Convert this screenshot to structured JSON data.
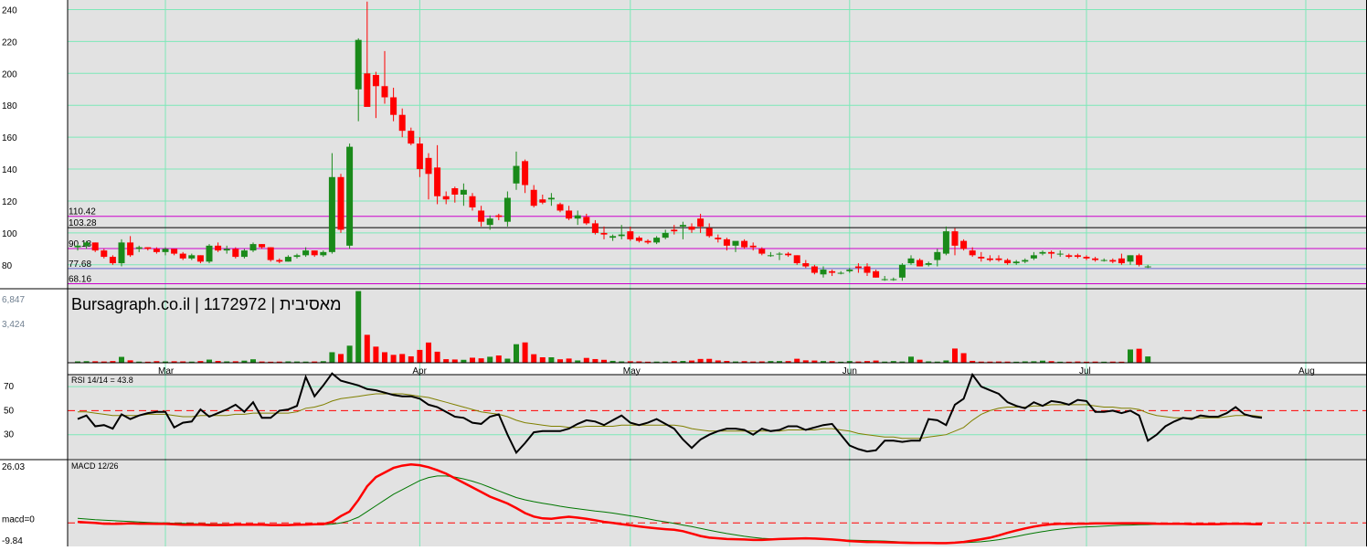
{
  "chart_data": {
    "type": "candlestick",
    "watermark": "Bursagraph.co.il | 1172972 | מאסיבית",
    "colors": {
      "up": "#1a8a1a",
      "down": "#ff0000",
      "grid": "#7de8b8",
      "panel_bg": "#e2e2e2",
      "level_magenta": "#cc00cc",
      "level_black": "#000000",
      "level_blue": "#6666cc"
    },
    "price": {
      "ylim": [
        65,
        246
      ],
      "yticks": [
        "80",
        "100",
        "120",
        "140",
        "160",
        "180",
        "200",
        "220",
        "240"
      ],
      "levels": [
        {
          "label": "110.42",
          "value": 110.42,
          "color": "#cc00cc"
        },
        {
          "label": "103.28",
          "value": 103.28,
          "color": "#000000"
        },
        {
          "label": "90.18",
          "value": 90.18,
          "color": "#cc00cc"
        },
        {
          "label": "77.68",
          "value": 77.68,
          "color": "#6666cc"
        },
        {
          "label": "68.16",
          "value": 68.16,
          "color": "#cc00cc"
        }
      ]
    },
    "months": [
      {
        "label": "Mar",
        "index": 10
      },
      {
        "label": "Apr",
        "index": 39
      },
      {
        "label": "May",
        "index": 63
      },
      {
        "label": "Jun",
        "index": 88
      },
      {
        "label": "Jul",
        "index": 115
      },
      {
        "label": "Aug",
        "index": 140
      }
    ],
    "candles": [
      [
        91,
        93,
        89,
        92
      ],
      [
        92,
        95,
        90,
        94
      ],
      [
        94,
        94,
        88,
        89
      ],
      [
        89,
        90,
        84,
        85
      ],
      [
        85,
        86,
        80,
        81
      ],
      [
        81,
        96,
        79,
        94
      ],
      [
        94,
        98,
        85,
        86
      ],
      [
        90,
        92,
        88,
        91
      ],
      [
        91,
        91,
        89,
        90
      ],
      [
        90,
        91,
        87,
        88
      ],
      [
        88,
        91,
        86,
        90
      ],
      [
        90,
        90,
        86,
        87
      ],
      [
        87,
        88,
        83,
        84
      ],
      [
        84,
        87,
        83,
        86
      ],
      [
        86,
        86,
        81,
        82
      ],
      [
        82,
        93,
        81,
        92
      ],
      [
        92,
        94,
        88,
        89
      ],
      [
        89,
        92,
        87,
        90
      ],
      [
        90,
        91,
        84,
        85
      ],
      [
        85,
        90,
        84,
        89
      ],
      [
        89,
        94,
        88,
        93
      ],
      [
        93,
        93,
        90,
        91
      ],
      [
        91,
        91,
        82,
        83
      ],
      [
        83,
        84,
        81,
        82
      ],
      [
        82,
        86,
        82,
        85
      ],
      [
        85,
        87,
        84,
        86
      ],
      [
        86,
        91,
        85,
        89
      ],
      [
        89,
        89,
        85,
        86
      ],
      [
        86,
        89,
        85,
        88
      ],
      [
        88,
        150,
        87,
        135
      ],
      [
        135,
        137,
        100,
        102
      ],
      [
        92,
        156,
        90,
        154
      ],
      [
        190,
        222,
        170,
        221
      ],
      [
        200,
        245,
        196,
        179
      ],
      [
        199,
        201,
        172,
        192
      ],
      [
        192,
        214,
        181,
        185
      ],
      [
        185,
        191,
        170,
        174
      ],
      [
        174,
        178,
        160,
        164
      ],
      [
        164,
        166,
        155,
        156
      ],
      [
        156,
        160,
        135,
        140
      ],
      [
        147,
        150,
        121,
        137
      ],
      [
        141,
        155,
        118,
        123
      ],
      [
        123,
        126,
        118,
        121
      ],
      [
        128,
        129,
        119,
        124
      ],
      [
        124,
        131,
        117,
        127
      ],
      [
        123,
        125,
        114,
        116
      ],
      [
        114,
        117,
        104,
        107
      ],
      [
        105,
        111,
        102,
        109
      ],
      [
        111,
        112,
        108,
        110
      ],
      [
        107,
        126,
        104,
        122
      ],
      [
        131,
        151,
        127,
        142
      ],
      [
        145,
        146,
        125,
        130
      ],
      [
        127,
        130,
        116,
        117
      ],
      [
        121,
        124,
        118,
        119
      ],
      [
        121,
        125,
        117,
        122
      ],
      [
        118,
        119,
        113,
        114
      ],
      [
        114,
        117,
        108,
        109
      ],
      [
        109,
        114,
        105,
        111
      ],
      [
        110,
        112,
        105,
        106
      ],
      [
        106,
        108,
        99,
        100
      ],
      [
        100,
        104,
        96,
        99
      ],
      [
        97,
        99,
        95,
        98
      ],
      [
        98,
        105,
        96,
        99
      ],
      [
        101,
        104,
        95,
        96
      ],
      [
        97,
        98,
        94,
        95
      ],
      [
        95,
        96,
        93,
        94
      ],
      [
        94,
        98,
        93,
        97
      ],
      [
        97,
        102,
        96,
        100
      ],
      [
        102,
        105,
        99,
        101
      ],
      [
        104,
        107,
        96,
        105
      ],
      [
        104,
        106,
        100,
        102
      ],
      [
        109,
        112,
        100,
        104
      ],
      [
        103,
        106,
        97,
        98
      ],
      [
        97,
        99,
        94,
        96
      ],
      [
        96,
        97,
        89,
        92
      ],
      [
        92,
        94,
        88,
        95
      ],
      [
        95,
        96,
        90,
        91
      ],
      [
        92,
        94,
        89,
        91
      ],
      [
        90,
        91,
        86,
        87
      ],
      [
        86,
        88,
        85,
        86
      ],
      [
        87,
        88,
        83,
        87
      ],
      [
        87,
        88,
        85,
        86
      ],
      [
        86,
        86,
        80,
        81
      ],
      [
        81,
        83,
        78,
        79
      ],
      [
        79,
        80,
        74,
        75
      ],
      [
        74,
        79,
        72,
        77
      ],
      [
        76,
        77,
        73,
        75
      ],
      [
        75,
        76,
        74,
        75
      ],
      [
        76,
        78,
        75,
        77
      ],
      [
        79,
        81,
        75,
        78
      ],
      [
        79,
        81,
        73,
        75
      ],
      [
        76,
        77,
        72,
        72
      ],
      [
        71,
        73,
        70,
        71
      ],
      [
        71,
        72,
        70,
        71
      ],
      [
        72,
        81,
        70,
        80
      ],
      [
        81,
        86,
        80,
        84
      ],
      [
        83,
        84,
        79,
        79
      ],
      [
        80,
        82,
        79,
        81
      ],
      [
        83,
        90,
        79,
        88
      ],
      [
        87,
        104,
        86,
        101
      ],
      [
        101,
        103,
        86,
        92
      ],
      [
        95,
        96,
        89,
        90
      ],
      [
        89,
        91,
        85,
        86
      ],
      [
        85,
        88,
        82,
        84
      ],
      [
        84,
        86,
        82,
        83
      ],
      [
        84,
        86,
        82,
        83
      ],
      [
        83,
        84,
        80,
        81
      ],
      [
        81,
        83,
        80,
        82
      ],
      [
        82,
        84,
        81,
        83
      ],
      [
        84,
        88,
        83,
        86
      ],
      [
        87,
        89,
        86,
        88
      ],
      [
        88,
        89,
        84,
        87
      ],
      [
        87,
        89,
        85,
        87
      ],
      [
        86,
        87,
        84,
        85
      ],
      [
        86,
        87,
        84,
        85
      ],
      [
        85,
        86,
        83,
        84
      ],
      [
        84,
        85,
        82,
        83
      ],
      [
        83,
        84,
        82,
        83
      ],
      [
        83,
        84,
        81,
        82
      ],
      [
        84,
        87,
        80,
        81
      ],
      [
        82,
        86,
        80,
        86
      ],
      [
        86,
        87,
        79,
        80
      ],
      [
        79,
        80,
        78,
        79
      ]
    ],
    "volume": {
      "yticks": [
        "6,847",
        "3,424"
      ],
      "max": 6847,
      "values": [
        130,
        150,
        140,
        120,
        160,
        560,
        230,
        110,
        100,
        150,
        120,
        140,
        130,
        110,
        160,
        300,
        170,
        130,
        140,
        200,
        330,
        120,
        100,
        110,
        130,
        120,
        110,
        120,
        150,
        1000,
        830,
        1620,
        6800,
        2650,
        1530,
        1000,
        750,
        830,
        610,
        1220,
        1920,
        1050,
        340,
        310,
        280,
        480,
        420,
        570,
        690,
        390,
        1760,
        1930,
        810,
        520,
        520,
        330,
        400,
        220,
        460,
        350,
        280,
        180,
        130,
        140,
        130,
        100,
        110,
        110,
        150,
        170,
        210,
        360,
        370,
        220,
        170,
        120,
        150,
        120,
        130,
        160,
        160,
        160,
        380,
        230,
        210,
        160,
        150,
        100,
        160,
        120,
        160,
        210,
        110,
        160,
        120,
        580,
        290,
        130,
        110,
        220,
        1350,
        910,
        180,
        110,
        110,
        120,
        110,
        100,
        130,
        140,
        200,
        150,
        100,
        100,
        120,
        100,
        110,
        100,
        110,
        100,
        1260,
        1330,
        600
      ]
    },
    "rsi": {
      "label": "RSI 14/14 = 43.8",
      "yticks": [
        "70",
        "50",
        "30"
      ],
      "ylim": [
        10,
        80
      ],
      "values": [
        43,
        46,
        37,
        38,
        35,
        47,
        43,
        46,
        48,
        49,
        49,
        36,
        40,
        41,
        51,
        45,
        48,
        51,
        55,
        49,
        57,
        44,
        44,
        50,
        51,
        54,
        78,
        62,
        71,
        81,
        75,
        73,
        71,
        68,
        67,
        65,
        63,
        62,
        62,
        60,
        55,
        53,
        49,
        45,
        44,
        40,
        39,
        45,
        47,
        30,
        15,
        23,
        32,
        33,
        33,
        33,
        35,
        39,
        42,
        41,
        38,
        42,
        46,
        40,
        38,
        40,
        43,
        39,
        35,
        26,
        19,
        26,
        30,
        33,
        35,
        35,
        34,
        30,
        35,
        33,
        34,
        37,
        37,
        34,
        36,
        38,
        39,
        30,
        21,
        18,
        16,
        17,
        25,
        25,
        24,
        25,
        25,
        43,
        42,
        38,
        55,
        60,
        80,
        70,
        67,
        64,
        57,
        54,
        52,
        57,
        54,
        58,
        57,
        55,
        59,
        58,
        49,
        49,
        50,
        48,
        50,
        46,
        25,
        30,
        37,
        41,
        44,
        43,
        46,
        45,
        45,
        48,
        53,
        47,
        45,
        44
      ],
      "signal": [
        49,
        49,
        48,
        47,
        46,
        46,
        46,
        46,
        47,
        47,
        47,
        46,
        45,
        45,
        46,
        46,
        46,
        46,
        47,
        47,
        48,
        48,
        48,
        48,
        48,
        49,
        52,
        53,
        55,
        58,
        60,
        61,
        62,
        63,
        64,
        64,
        64,
        64,
        63,
        62,
        61,
        59,
        57,
        55,
        53,
        51,
        49,
        48,
        47,
        45,
        42,
        40,
        39,
        38,
        37,
        37,
        36,
        36,
        37,
        37,
        37,
        37,
        38,
        38,
        38,
        38,
        38,
        38,
        38,
        37,
        35,
        34,
        33,
        33,
        33,
        33,
        33,
        33,
        33,
        33,
        33,
        34,
        34,
        34,
        34,
        35,
        35,
        34,
        33,
        31,
        30,
        29,
        28,
        28,
        27,
        27,
        27,
        28,
        29,
        30,
        33,
        36,
        42,
        47,
        50,
        52,
        53,
        53,
        53,
        54,
        54,
        55,
        55,
        55,
        55,
        55,
        54,
        53,
        53,
        52,
        52,
        51,
        48,
        46,
        45,
        44,
        44,
        44,
        44,
        44,
        44,
        45,
        46,
        46,
        46,
        45
      ]
    },
    "macd": {
      "label": "MACD 12/26",
      "yticks": [
        "26.03",
        "macd=0",
        "-9.84"
      ],
      "ylim": [
        -9.84,
        26.03
      ],
      "zero_label": "macd=0",
      "values": [
        0.5,
        0.2,
        0,
        -0.3,
        -0.4,
        -0.3,
        -0.2,
        -0.3,
        -0.3,
        -0.4,
        -0.4,
        -0.6,
        -0.8,
        -0.8,
        -0.8,
        -0.9,
        -0.9,
        -0.9,
        -0.8,
        -0.8,
        -0.7,
        -0.8,
        -0.9,
        -0.9,
        -0.9,
        -0.8,
        -0.7,
        -0.6,
        -0.5,
        0.5,
        3,
        5,
        10,
        16,
        20,
        22,
        24,
        25,
        25.5,
        25.2,
        24.3,
        23,
        21.5,
        19.5,
        17.5,
        15.5,
        13.5,
        11.5,
        10,
        8.5,
        6.5,
        4.3,
        2.8,
        2,
        1.8,
        2.3,
        2.7,
        2.3,
        1.8,
        1.2,
        0.5,
        0,
        -0.5,
        -1,
        -1.5,
        -2,
        -2.4,
        -2.7,
        -3,
        -3.6,
        -4.6,
        -5.7,
        -6.4,
        -6.7,
        -7,
        -7.1,
        -7.2,
        -7.4,
        -7.4,
        -7.2,
        -7,
        -6.9,
        -6.8,
        -6.7,
        -6.8,
        -7,
        -7.2,
        -7.5,
        -7.9,
        -8.1,
        -8.3,
        -8.3,
        -8.4,
        -8.5,
        -8.6,
        -8.7,
        -8.7,
        -8.7,
        -8.8,
        -8.8,
        -8.6,
        -8.3,
        -7.7,
        -7.1,
        -6.4,
        -5.4,
        -4.3,
        -3.3,
        -2.4,
        -1.6,
        -1,
        -0.6,
        -0.4,
        -0.4,
        -0.3,
        -0.3,
        -0.2,
        -0.2,
        -0.2,
        -0.1,
        -0.1,
        -0.1,
        -0.2,
        -0.3,
        -0.4,
        -0.4,
        -0.4,
        -0.5,
        -0.5,
        -0.5,
        -0.5,
        -0.4,
        -0.3,
        -0.4,
        -0.5,
        -0.6
      ],
      "signal": [
        2,
        1.7,
        1.4,
        1.2,
        1,
        0.8,
        0.6,
        0.4,
        0.2,
        0.1,
        0,
        -0.1,
        -0.2,
        -0.3,
        -0.4,
        -0.5,
        -0.6,
        -0.6,
        -0.7,
        -0.7,
        -0.7,
        -0.7,
        -0.8,
        -0.8,
        -0.8,
        -0.8,
        -0.8,
        -0.7,
        -0.7,
        -0.5,
        0,
        1,
        2.5,
        5,
        7.5,
        10,
        12.5,
        14.5,
        16.5,
        18.5,
        19.8,
        20.5,
        20.5,
        20,
        19.2,
        18.2,
        17,
        15.5,
        14,
        12.5,
        11.1,
        10.1,
        9.3,
        8.6,
        8,
        7.3,
        6.7,
        6.2,
        5.7,
        5.2,
        4.8,
        4.3,
        3.7,
        3.1,
        2.5,
        1.8,
        1.1,
        0.5,
        -0.2,
        -0.9,
        -1.6,
        -2.4,
        -3.2,
        -3.9,
        -4.6,
        -5.2,
        -5.8,
        -6.3,
        -6.7,
        -6.9,
        -7,
        -7,
        -7,
        -7,
        -7,
        -7.1,
        -7.2,
        -7.3,
        -7.5,
        -7.6,
        -7.7,
        -7.8,
        -7.9,
        -8.1,
        -8.3,
        -8.4,
        -8.5,
        -8.6,
        -8.7,
        -8.7,
        -8.7,
        -8.6,
        -8.4,
        -8.2,
        -7.8,
        -7.3,
        -6.6,
        -5.9,
        -5.1,
        -4.4,
        -3.8,
        -3.2,
        -2.7,
        -2.3,
        -1.9,
        -1.7,
        -1.6,
        -1.4,
        -1.2,
        -1,
        -0.9,
        -0.8,
        -0.7,
        -0.6,
        -0.6,
        -0.5,
        -0.5,
        -0.5,
        -0.5,
        -0.5,
        -0.4,
        -0.4,
        -0.4,
        -0.4,
        -0.4,
        -0.4
      ]
    }
  }
}
